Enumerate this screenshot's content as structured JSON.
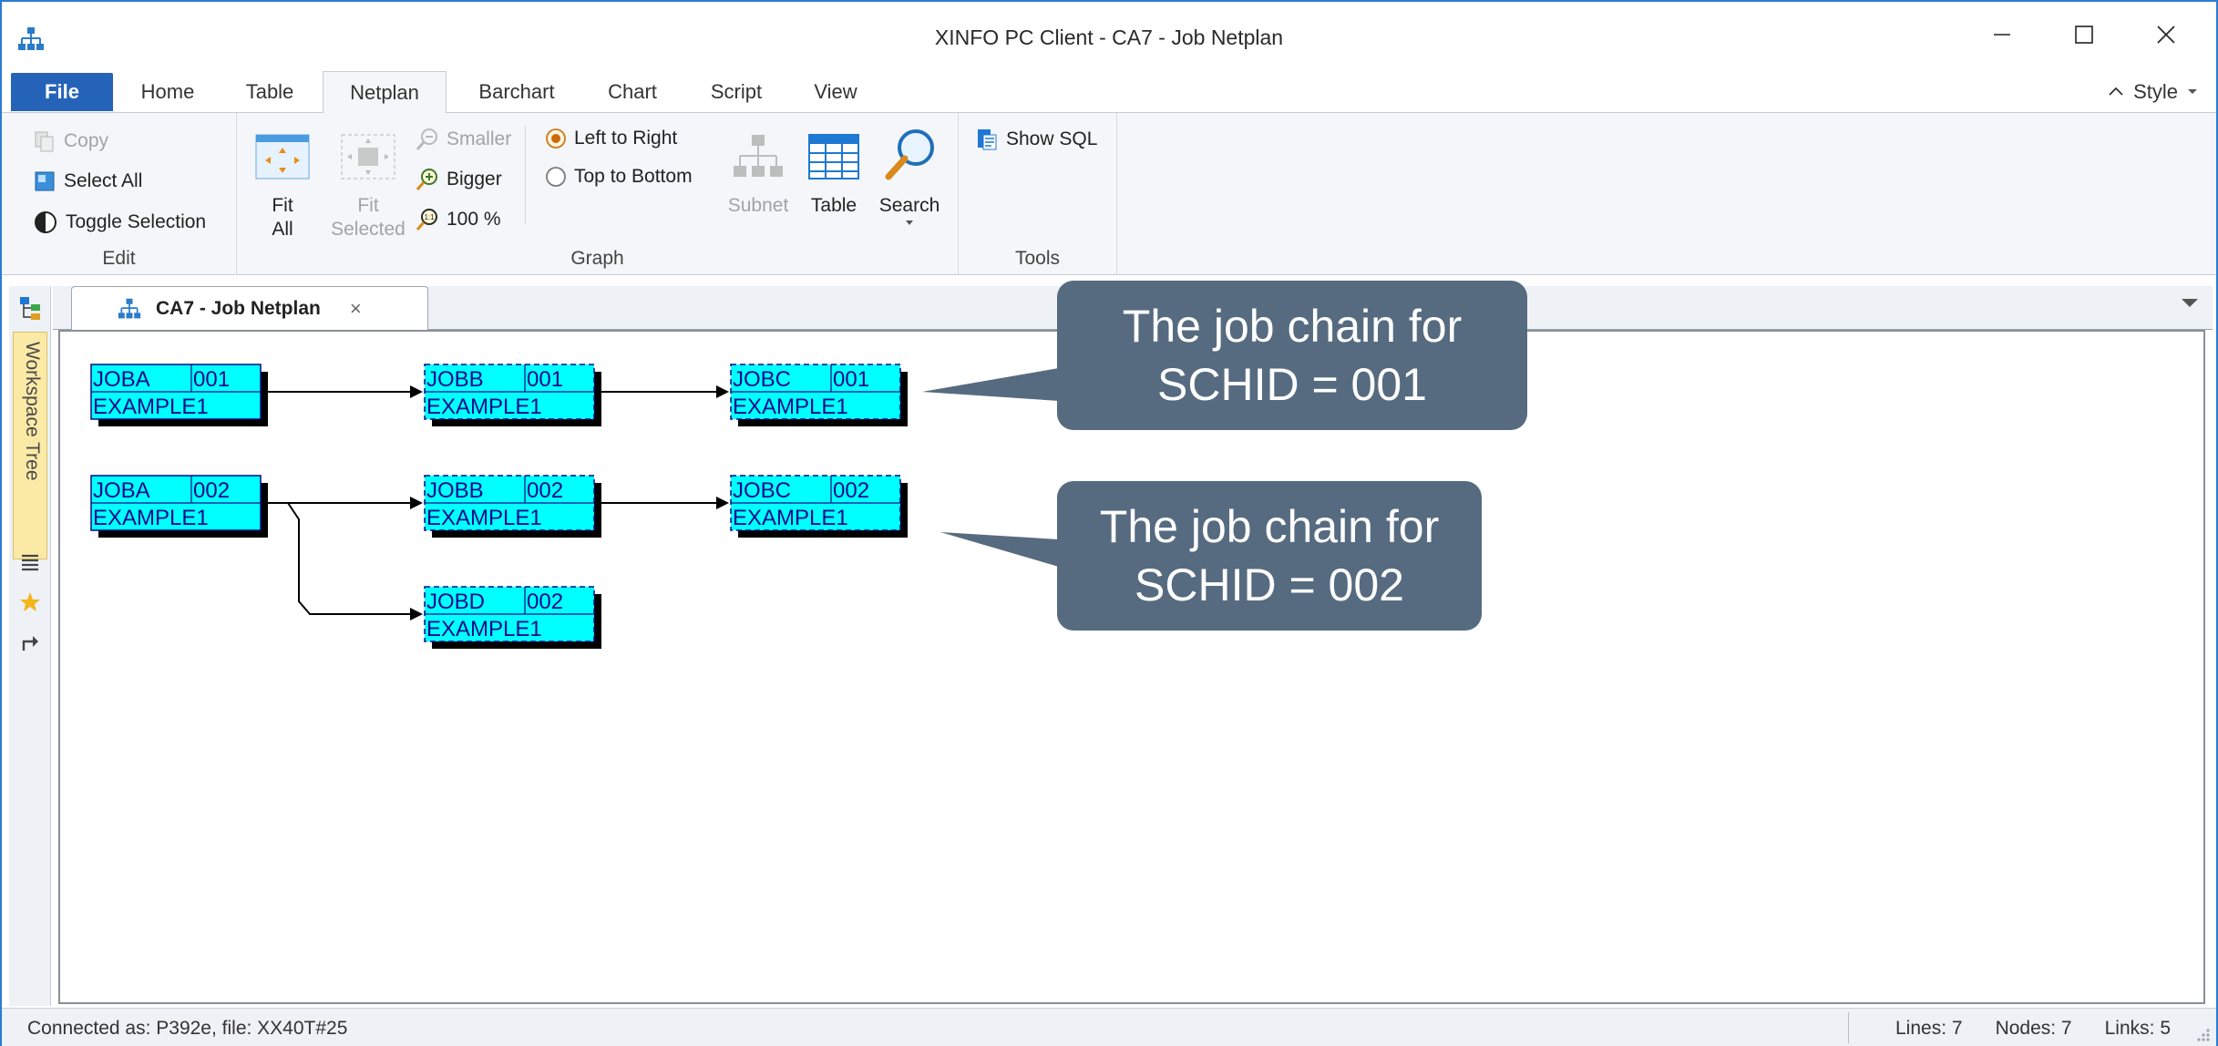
{
  "window": {
    "title": "XINFO PC Client - CA7 - Job Netplan"
  },
  "ribbon": {
    "tabs": {
      "file": "File",
      "home": "Home",
      "table": "Table",
      "netplan": "Netplan",
      "barchart": "Barchart",
      "chart": "Chart",
      "script": "Script",
      "view": "View"
    },
    "style_label": "Style",
    "edit": {
      "label": "Edit",
      "copy": "Copy",
      "select_all": "Select All",
      "toggle_selection": "Toggle Selection"
    },
    "graph": {
      "label": "Graph",
      "fit_all_1": "Fit",
      "fit_all_2": "All",
      "fit_selected_1": "Fit",
      "fit_selected_2": "Selected",
      "smaller": "Smaller",
      "bigger": "Bigger",
      "zoom_100": "100 %",
      "left_to_right": "Left to Right",
      "top_to_bottom": "Top to Bottom",
      "subnet": "Subnet",
      "table": "Table",
      "search": "Search",
      "selected_orientation": "Left to Right"
    },
    "tools": {
      "label": "Tools",
      "show_sql": "Show SQL"
    }
  },
  "sidebar": {
    "workspace_tree": "Workspace Tree"
  },
  "document_tab": {
    "label": "CA7 - Job Netplan"
  },
  "netplan": {
    "nodes": [
      {
        "id": "a1",
        "job": "JOBA",
        "schid": "001",
        "name": "EXAMPLE1",
        "selected": false
      },
      {
        "id": "b1",
        "job": "JOBB",
        "schid": "001",
        "name": "EXAMPLE1",
        "selected": true
      },
      {
        "id": "c1",
        "job": "JOBC",
        "schid": "001",
        "name": "EXAMPLE1",
        "selected": true
      },
      {
        "id": "a2",
        "job": "JOBA",
        "schid": "002",
        "name": "EXAMPLE1",
        "selected": false
      },
      {
        "id": "b2",
        "job": "JOBB",
        "schid": "002",
        "name": "EXAMPLE1",
        "selected": true
      },
      {
        "id": "c2",
        "job": "JOBC",
        "schid": "002",
        "name": "EXAMPLE1",
        "selected": true
      },
      {
        "id": "d2",
        "job": "JOBD",
        "schid": "002",
        "name": "EXAMPLE1",
        "selected": true
      }
    ],
    "links": [
      {
        "from": "a1",
        "to": "b1"
      },
      {
        "from": "b1",
        "to": "c1"
      },
      {
        "from": "a2",
        "to": "b2"
      },
      {
        "from": "b2",
        "to": "c2"
      },
      {
        "from": "a2",
        "to": "d2"
      }
    ],
    "colors": {
      "node_fill": "#00ffff",
      "node_shadow": "#000000",
      "node_text": "#0a0a8a",
      "callout_bg": "#566b80"
    }
  },
  "callouts": {
    "first": {
      "line1": "The job chain for",
      "line2": "SCHID = 001"
    },
    "second": {
      "line1": "The job chain for",
      "line2": "SCHID = 002"
    }
  },
  "status": {
    "connected": "Connected as: P392e, file: XX40T#25",
    "lines": "Lines: 7",
    "nodes": "Nodes: 7",
    "links": "Links: 5"
  }
}
